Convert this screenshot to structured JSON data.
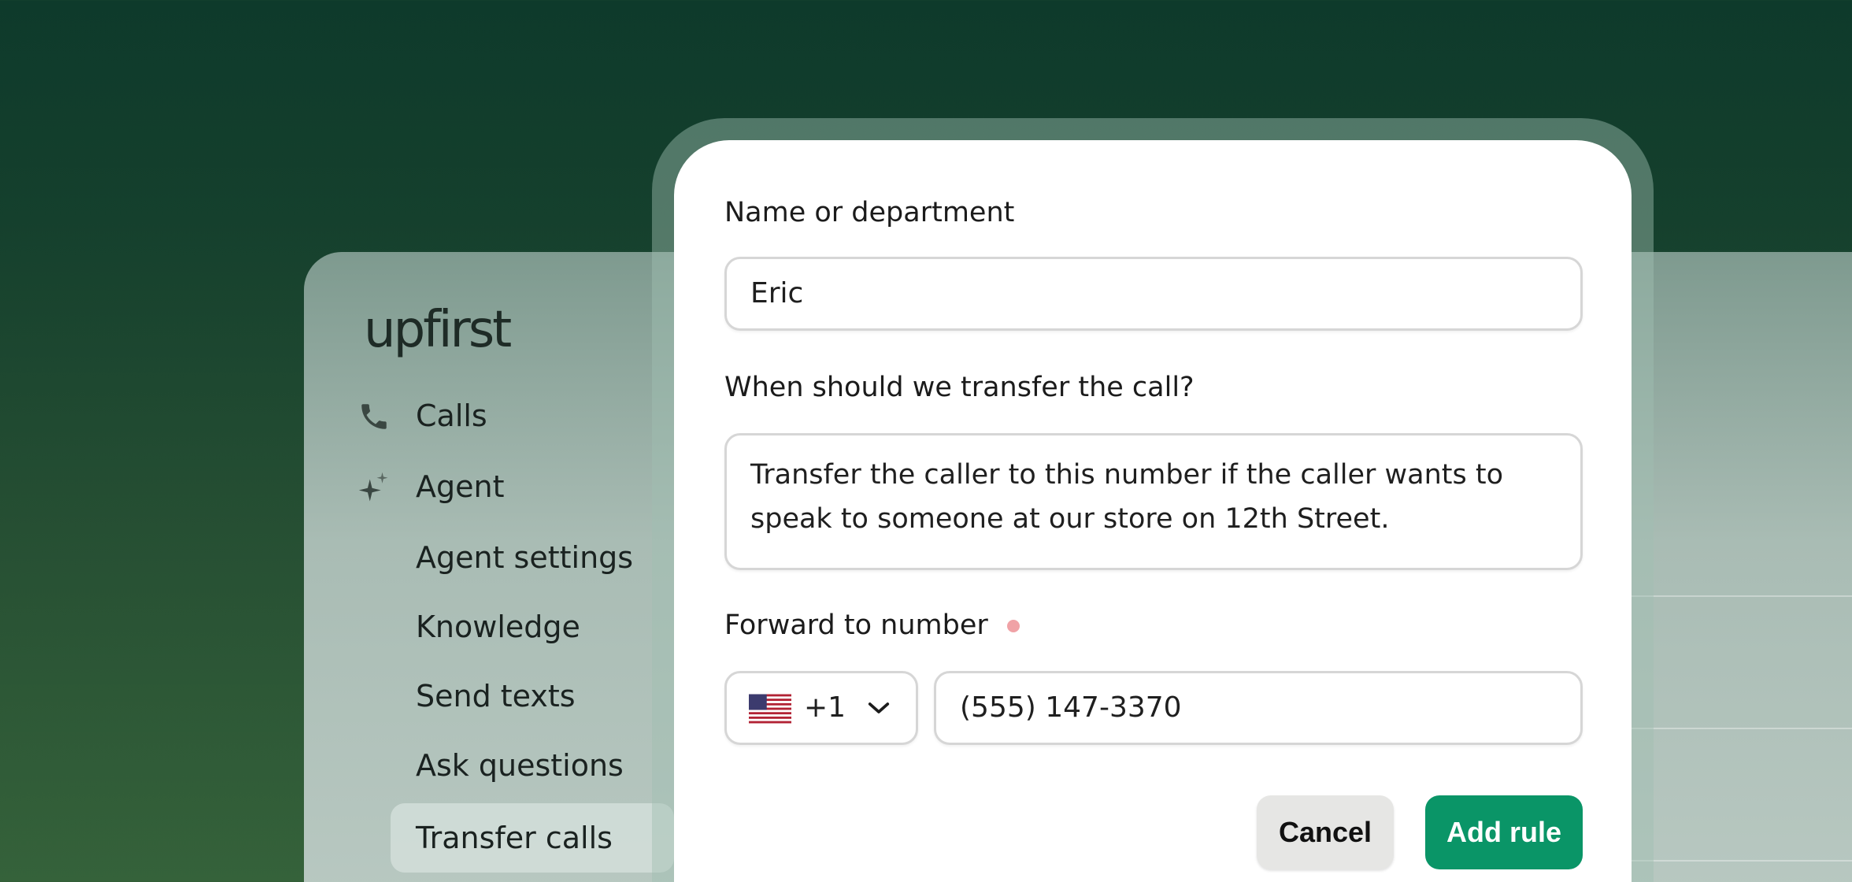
{
  "sidebar": {
    "logo": "upfirst",
    "items": [
      {
        "label": "Calls",
        "icon": "phone-icon"
      },
      {
        "label": "Agent",
        "icon": "sparkle-icon"
      },
      {
        "label": "Agent settings"
      },
      {
        "label": "Knowledge"
      },
      {
        "label": "Send texts"
      },
      {
        "label": "Ask questions"
      },
      {
        "label": "Transfer calls",
        "active": true
      }
    ]
  },
  "modal": {
    "name_label": "Name or department",
    "name_value": "Eric",
    "when_label": "When should we transfer the call?",
    "when_value": "Transfer the caller to this number if the caller wants to speak to someone at our store on 12th Street.",
    "forward_label": "Forward to number",
    "country_code": "+1",
    "country_flag": "us-flag-icon",
    "phone_value": "(555) 147-3370",
    "cancel_label": "Cancel",
    "add_label": "Add rule"
  },
  "colors": {
    "accent": "#0a9567",
    "required_dot": "#f0a2a6"
  }
}
